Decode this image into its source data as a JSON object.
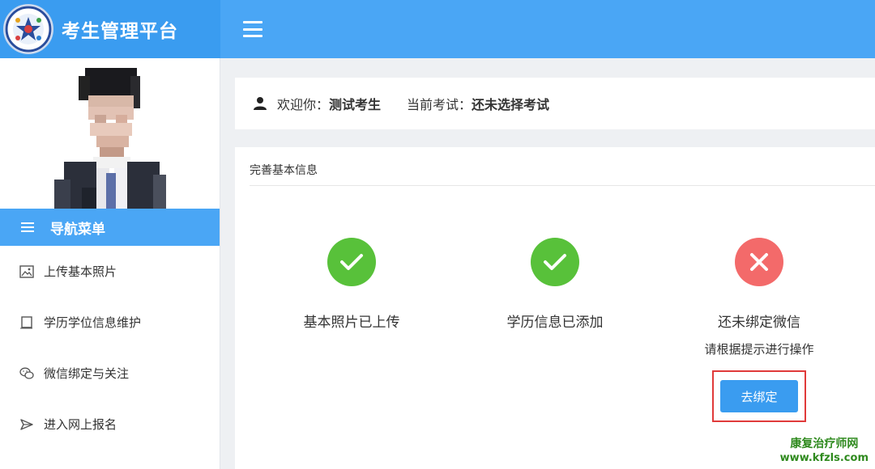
{
  "app": {
    "title": "考生管理平台"
  },
  "sidebar": {
    "nav_title": "导航菜单",
    "items": [
      {
        "label": "上传基本照片",
        "icon": "image-icon"
      },
      {
        "label": "学历学位信息维护",
        "icon": "book-icon"
      },
      {
        "label": "微信绑定与关注",
        "icon": "wechat-icon"
      },
      {
        "label": "进入网上报名",
        "icon": "send-icon"
      }
    ]
  },
  "welcome": {
    "greeting_label": "欢迎你：",
    "user_name": "测试考生",
    "exam_label": "当前考试：",
    "exam_value": "还未选择考试"
  },
  "panel": {
    "title": "完善基本信息",
    "statuses": [
      {
        "text": "基本照片已上传",
        "state": "ok"
      },
      {
        "text": "学历信息已添加",
        "state": "ok"
      },
      {
        "text": "还未绑定微信",
        "state": "error",
        "sub": "请根据提示进行操作",
        "button": "去绑定"
      }
    ]
  },
  "watermark": {
    "line1": "康复治疗师网",
    "line2": "www.kfzls.com"
  },
  "colors": {
    "primary": "#4aa6f5",
    "success": "#58c13a",
    "error": "#f36a6a",
    "highlight_border": "#e03a3a"
  }
}
